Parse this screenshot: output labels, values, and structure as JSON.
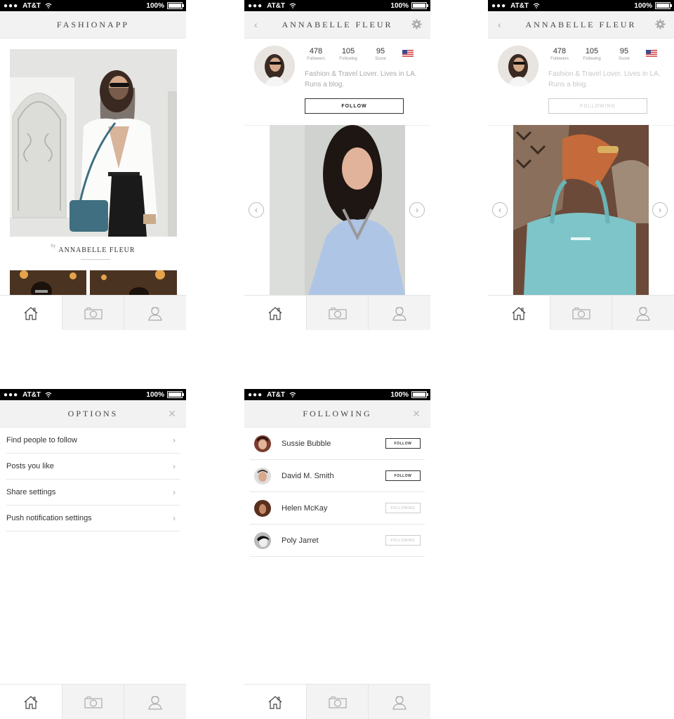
{
  "status_bar": {
    "carrier": "AT&T",
    "battery": "100%"
  },
  "screens": {
    "feed": {
      "title": "FASHIONAPP",
      "by_label": "by",
      "author": "ANNABELLE FLEUR"
    },
    "profile": {
      "title": "ANNABELLE FLEUR",
      "followers": "478",
      "followers_label": "Followers",
      "following": "105",
      "following_label": "Following",
      "score": "95",
      "score_label": "Score",
      "bio": "Fashion & Travel Lover. Lives in LA. Runs a blog.",
      "follow_label": "FOLLOW",
      "following_btn_label": "FOLLOWING"
    },
    "options": {
      "title": "OPTIONS",
      "items": [
        {
          "label": "Find people to follow"
        },
        {
          "label": "Posts you like"
        },
        {
          "label": "Share settings"
        },
        {
          "label": "Push notification settings"
        }
      ]
    },
    "following": {
      "title": "FOLLOWING",
      "people": [
        {
          "name": "Sussie Bubble",
          "button": "FOLLOW",
          "state": "follow"
        },
        {
          "name": "David M. Smith",
          "button": "FOLLOW",
          "state": "follow"
        },
        {
          "name": "Helen McKay",
          "button": "FOLLOWING",
          "state": "following"
        },
        {
          "name": "Poly Jarret",
          "button": "FOLLOWING",
          "state": "following"
        }
      ]
    }
  },
  "tabbar": {
    "icons": [
      "home-icon",
      "camera-icon",
      "profile-icon"
    ]
  },
  "colors": {
    "header_bg": "#f2f2f2",
    "status_bg": "#000000",
    "border": "#e4e4e4"
  }
}
